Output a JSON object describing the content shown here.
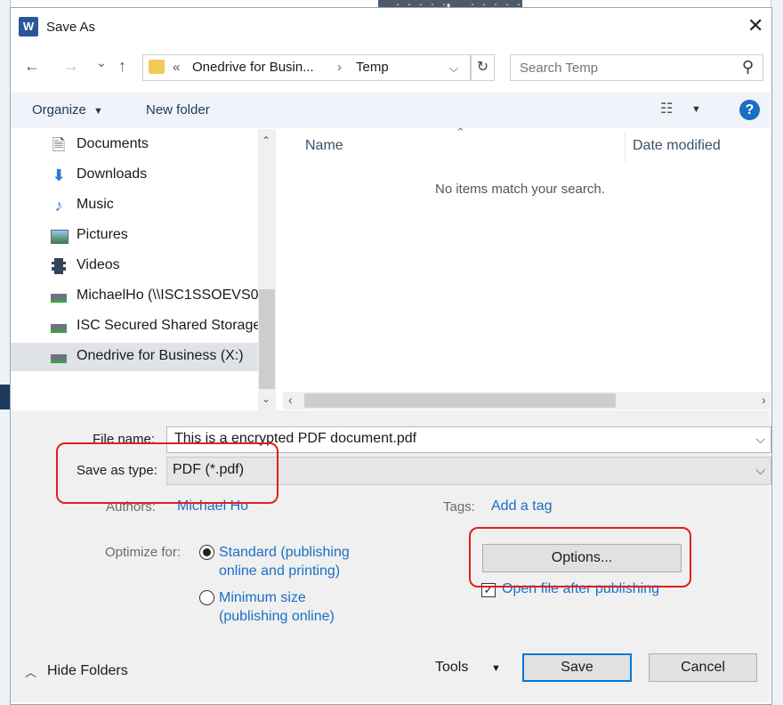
{
  "window": {
    "title": "Save As",
    "app_icon": "word-icon"
  },
  "nav": {
    "back": "←",
    "forward": "→",
    "recent": "⌄",
    "up": "↑"
  },
  "address": {
    "chevrons": "«",
    "segment1": "Onedrive for Busin...",
    "separator": "›",
    "segment2": "Temp"
  },
  "search": {
    "placeholder": "Search Temp"
  },
  "toolbar": {
    "organize": "Organize",
    "new_folder": "New folder",
    "help": "?"
  },
  "sidebar": {
    "items": [
      {
        "label": "Documents",
        "icon": "documents-icon"
      },
      {
        "label": "Downloads",
        "icon": "downloads-icon"
      },
      {
        "label": "Music",
        "icon": "music-icon"
      },
      {
        "label": "Pictures",
        "icon": "pictures-icon"
      },
      {
        "label": "Videos",
        "icon": "videos-icon"
      },
      {
        "label": "MichaelHo (\\\\ISC1SSOEVS0",
        "icon": "network-drive-icon"
      },
      {
        "label": "ISC Secured Shared Storage",
        "icon": "network-drive-icon"
      },
      {
        "label": "Onedrive for Business (X:)",
        "icon": "network-drive-icon",
        "selected": true
      }
    ]
  },
  "files": {
    "columns": {
      "name": "Name",
      "date_modified": "Date modified"
    },
    "empty_message": "No items match your search."
  },
  "form": {
    "file_name_label": "File name:",
    "file_name_value": "This is a encrypted PDF document.pdf",
    "save_type_label": "Save as type:",
    "save_type_value": "PDF (*.pdf)",
    "authors_label": "Authors:",
    "authors_value": "Michael Ho",
    "tags_label": "Tags:",
    "tags_value": "Add a tag",
    "optimize_label": "Optimize for:",
    "opt_standard_line1": "Standard (publishing",
    "opt_standard_line2": "online and printing)",
    "opt_minimum_line1": "Minimum size",
    "opt_minimum_line2": "(publishing online)",
    "options_button": "Options...",
    "open_after_label": "Open file after publishing"
  },
  "footer": {
    "hide_folders": "Hide Folders",
    "tools": "Tools",
    "save": "Save",
    "cancel": "Cancel"
  },
  "colors": {
    "accent": "#0078d7",
    "link": "#1a6fc7",
    "highlight": "#e02020"
  }
}
